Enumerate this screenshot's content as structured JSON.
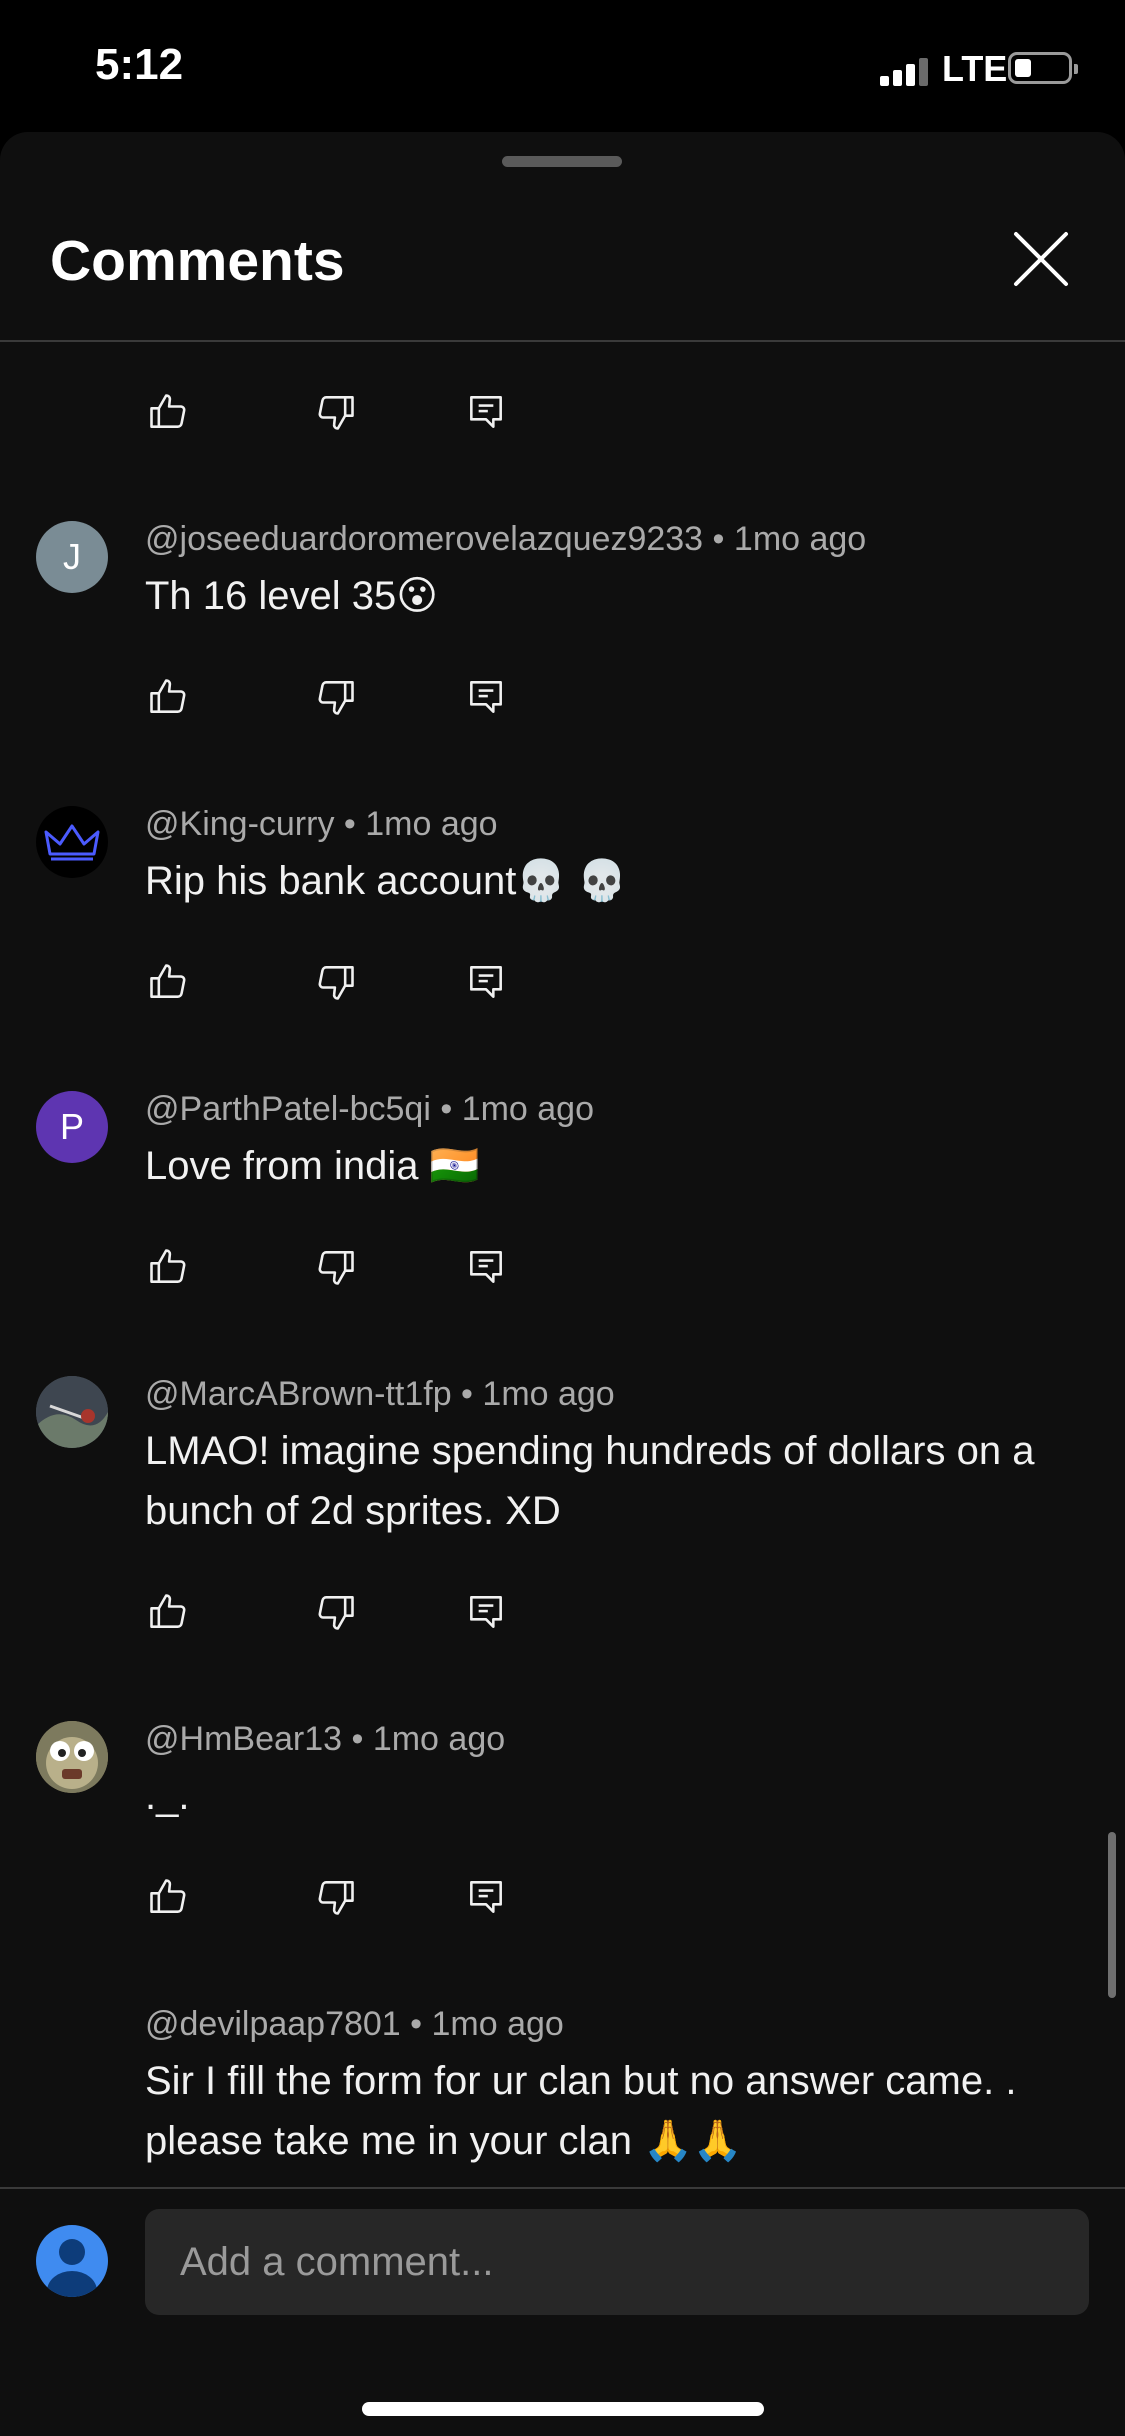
{
  "status_bar": {
    "time": "5:12",
    "network": "LTE"
  },
  "sheet": {
    "title": "Comments"
  },
  "comments": [
    {
      "author": "@joseeduardoromerovelazquez9233",
      "time": "1mo ago",
      "text": "Th 16 level 35😮",
      "avatar_letter": "J",
      "avatar_color": "#7a8c95"
    },
    {
      "author": "@King-curry",
      "time": "1mo ago",
      "text": "Rip his bank account💀 💀",
      "avatar_letter": "",
      "avatar_color": "#000000"
    },
    {
      "author": "@ParthPatel-bc5qi",
      "time": "1mo ago",
      "text": "Love from india 🇮🇳",
      "avatar_letter": "P",
      "avatar_color": "#5e35b1"
    },
    {
      "author": "@MarcABrown-tt1fp",
      "time": "1mo ago",
      "text": "LMAO! imagine spending hundreds of dollars on a bunch of 2d sprites. XD",
      "avatar_letter": "",
      "avatar_color": "#4a5058"
    },
    {
      "author": "@HmBear13",
      "time": "1mo ago",
      "text": "._.",
      "avatar_letter": "",
      "avatar_color": "#8a7a5a"
    },
    {
      "author": "@devilpaap7801",
      "time": "1mo ago",
      "text": "Sir I fill the form for ur clan but no answer came. . please take me in your clan 🙏🙏",
      "avatar_letter": "",
      "avatar_color": "#0f0f0f"
    }
  ],
  "composer": {
    "placeholder": "Add a comment..."
  },
  "colors": {
    "background": "#0f0f0f",
    "meta_text": "#aaaaaa",
    "input_bg": "#272727",
    "my_avatar": "#3f8bf0"
  }
}
